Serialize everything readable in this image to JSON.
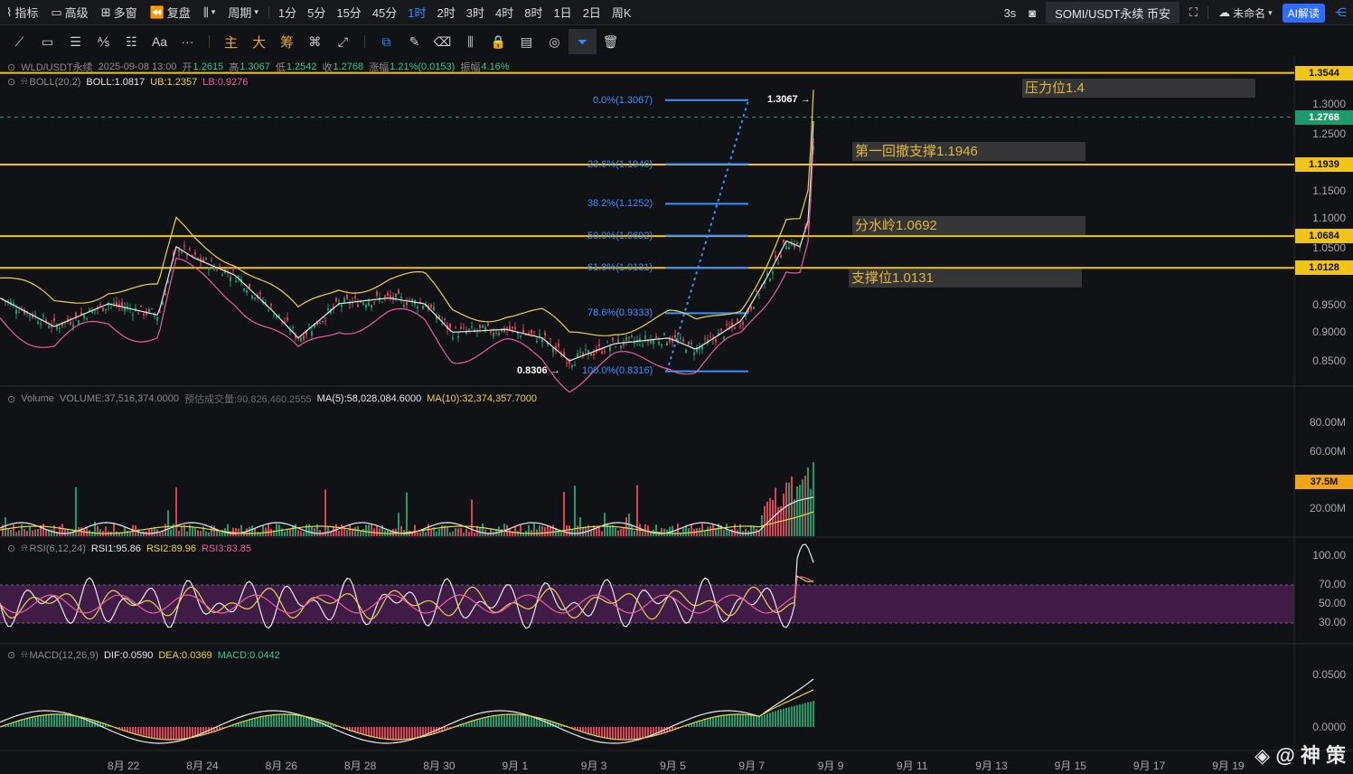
{
  "topbar": {
    "left": [
      {
        "name": "indicator",
        "label": "指标",
        "icon": "chart-line-icon"
      },
      {
        "name": "advanced",
        "label": "高级",
        "icon": "window-icon"
      },
      {
        "name": "multi-window",
        "label": "多窗",
        "icon": "grid-icon"
      },
      {
        "name": "replay",
        "label": "复盘",
        "icon": "rewind-icon"
      },
      {
        "name": "chart-type",
        "label": "",
        "icon": "candle-icon"
      },
      {
        "name": "period",
        "label": "周期",
        "icon": "chevron-down-icon"
      }
    ],
    "intervals": [
      "1分",
      "5分",
      "15分",
      "45分",
      "1时",
      "2时",
      "3时",
      "4时",
      "8时",
      "1日",
      "2日",
      "周K"
    ],
    "active_interval": "1时",
    "right": {
      "refresh": "3s",
      "symbol": "SOMI/USDT永续 币安",
      "layout_name": "未命名",
      "ai_label": "AI解读"
    }
  },
  "toolbar": {
    "tools": [
      {
        "name": "trendline",
        "glyph": "⟋",
        "tone": "normal"
      },
      {
        "name": "rectangle",
        "glyph": "▭",
        "tone": "normal"
      },
      {
        "name": "parallel-lines",
        "glyph": "☰",
        "tone": "normal"
      },
      {
        "name": "fib-tool",
        "glyph": "⅍",
        "tone": "normal"
      },
      {
        "name": "gann-tool",
        "glyph": "☷",
        "tone": "normal"
      },
      {
        "name": "text-tool",
        "glyph": "Aa",
        "tone": "normal"
      },
      {
        "name": "more-tools",
        "glyph": "···",
        "tone": "normal"
      },
      {
        "name": "main-chart",
        "glyph": "主",
        "tone": "yellow"
      },
      {
        "name": "large-orders",
        "glyph": "大",
        "tone": "yellow"
      },
      {
        "name": "chips",
        "glyph": "筹",
        "tone": "yellow"
      },
      {
        "name": "magnet",
        "glyph": "⌘",
        "tone": "normal"
      },
      {
        "name": "measure",
        "glyph": "⤢",
        "tone": "normal"
      },
      {
        "name": "copy",
        "glyph": "⧉",
        "tone": "blue"
      },
      {
        "name": "pencil",
        "glyph": "✎",
        "tone": "normal"
      },
      {
        "name": "eraser",
        "glyph": "⌫",
        "tone": "normal"
      },
      {
        "name": "candles-compare",
        "glyph": "⫼",
        "tone": "normal"
      },
      {
        "name": "lock",
        "glyph": "🔒",
        "tone": "normal"
      },
      {
        "name": "notes",
        "glyph": "▤",
        "tone": "normal"
      },
      {
        "name": "visibility",
        "glyph": "◎",
        "tone": "normal"
      },
      {
        "name": "filter",
        "glyph": "⏷",
        "tone": "selected"
      },
      {
        "name": "trash",
        "glyph": "🗑",
        "tone": "normal"
      }
    ]
  },
  "ohlc": {
    "symbol": "WLD/USDT永续",
    "datetime": "2025-09-08 13:00",
    "open_label": "开",
    "open": "1.2615",
    "high_label": "高",
    "high": "1.3067",
    "low_label": "低",
    "low": "1.2542",
    "close_label": "收",
    "close": "1.2768",
    "change_label": "涨幅",
    "change": "1.21%(0.0153)",
    "amp_label": "振幅",
    "amp": "4.16%"
  },
  "boll": {
    "name": "BOLL(20,2)",
    "boll": "BOLL:1.0817",
    "ub": "UB:1.2357",
    "lb": "LB:0.9276"
  },
  "volume_info": {
    "name": "Volume",
    "volume": "VOLUME:37,516,374.0000",
    "estimated": "预估成交量:90,826,460.2555",
    "ma5": "MA(5):58,028,084.6000",
    "ma10": "MA(10):32,374,357.7000"
  },
  "rsi_info": {
    "name": "RSI(6,12,24)",
    "rsi1": "RSI1:95.86",
    "rsi2": "RSI2:89.96",
    "rsi3": "RSI3:83.85"
  },
  "macd_info": {
    "name": "MACD(12,26,9)",
    "dif": "DIF:0.0590",
    "dea": "DEA:0.0369",
    "macd": "MACD:0.0442"
  },
  "annotations": [
    {
      "text": "压力位1.4",
      "price": 1.4
    },
    {
      "text": "第一回撤支撑1.1946",
      "price": 1.1946
    },
    {
      "text": "分水岭1.0692",
      "price": 1.0692
    },
    {
      "text": "支撑位1.0131",
      "price": 1.0131
    }
  ],
  "horizontal_lines": [
    {
      "label": "1.3544",
      "price": 1.3544
    },
    {
      "label": "1.1939",
      "price": 1.1939
    },
    {
      "label": "1.0684",
      "price": 1.0684
    },
    {
      "label": "1.0128",
      "price": 1.0128
    }
  ],
  "last_price": {
    "label": "1.2768",
    "price": 1.2768
  },
  "fib_levels": [
    {
      "label": "0.0%(1.3067)",
      "price": 1.3067
    },
    {
      "label": "23.6%(1.1946)",
      "price": 1.1946
    },
    {
      "label": "38.2%(1.1252)",
      "price": 1.1252
    },
    {
      "label": "50.0%(1.0692)",
      "price": 1.0692
    },
    {
      "label": "61.8%(1.0131)",
      "price": 1.0131
    },
    {
      "label": "78.6%(0.9333)",
      "price": 0.9333
    },
    {
      "label": "100.0%(0.8316)",
      "price": 0.8316
    }
  ],
  "high_marker": "1.3067 →",
  "low_marker": "0.8306 →",
  "price_axis": [
    "1.3000",
    "1.2500",
    "1.1500",
    "1.1000",
    "1.0500",
    "0.9500",
    "0.9000",
    "0.8500"
  ],
  "volume_axis": [
    "80.00M",
    "60.00M",
    "20.00M"
  ],
  "volume_tag": "37.5M",
  "rsi_axis": [
    "100.00",
    "70.00",
    "50.00",
    "30.00"
  ],
  "macd_axis": [
    "0.0500",
    "0.0000"
  ],
  "x_axis": [
    "8月 22",
    "8月 24",
    "8月 26",
    "8月 28",
    "8月 30",
    "9月 1",
    "9月 3",
    "9月 5",
    "9月 7",
    "9月 9",
    "9月 11",
    "9月 13",
    "9月 15",
    "9月 17",
    "9月 19"
  ],
  "watermark": "◈ @ 神 策",
  "colors": {
    "accent": "#2f8cff",
    "line_yellow": "#f0c419",
    "up": "#1e9b6d",
    "down": "#d9435a",
    "fib": "#3d8fff",
    "annotation_text": "#e0b73c"
  }
}
